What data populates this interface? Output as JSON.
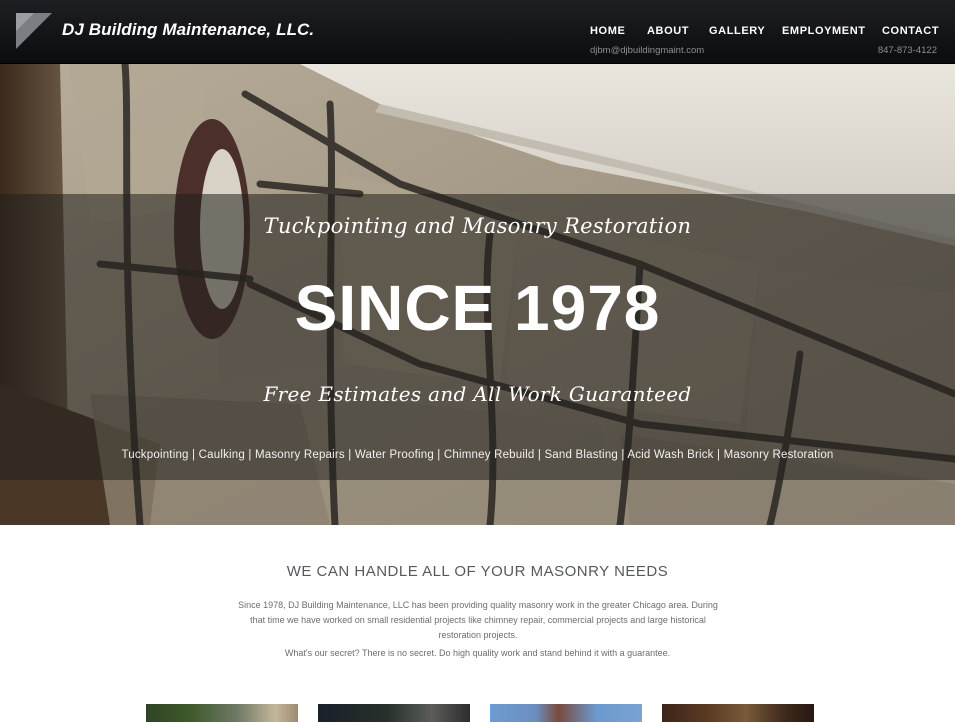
{
  "header": {
    "logo_text": "DJ  Building Maintenance, LLC.",
    "nav": [
      {
        "label": "HOME"
      },
      {
        "label": "ABOUT"
      },
      {
        "label": "GALLERY"
      },
      {
        "label": "EMPLOYMENT"
      },
      {
        "label": "CONTACT"
      }
    ],
    "email": "djbm@djbuildingmaint.com",
    "phone": "847-873-4122"
  },
  "hero": {
    "tagline": "Tuckpointing and Masonry Restoration",
    "title": "SINCE 1978",
    "subtitle": "Free Estimates and All Work Guaranteed",
    "services": "Tuckpointing | Caulking | Masonry Repairs | Water Proofing | Chimney Rebuild | Sand Blasting | Acid Wash Brick | Masonry Restoration"
  },
  "intro": {
    "heading": "WE CAN HANDLE ALL OF YOUR MASONRY NEEDS",
    "body": "Since 1978, DJ Building Maintenance, LLC has been providing quality masonry work in the greater Chicago area. During that time we have worked on small residential projects like chimney repair, commercial projects and large historical restoration projects.",
    "secret": "What's our secret? There is no secret. Do high quality work and stand behind it with a guarantee."
  },
  "colors": {
    "header_bg": "#0b0c0e",
    "nav_text": "#ffffff",
    "contact_text": "#8b8f94",
    "heading_text": "#555a5f"
  },
  "icons": {
    "logo": "triangle-logo-icon"
  }
}
